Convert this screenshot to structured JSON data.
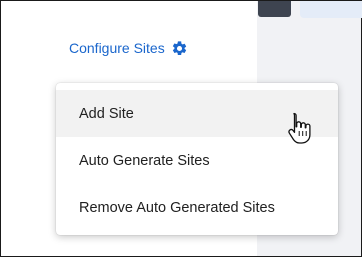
{
  "configure": {
    "label": "Configure Sites",
    "icon": "gear-icon",
    "color": "#1a66cc"
  },
  "menu": {
    "items": [
      {
        "label": "Add Site",
        "hovered": true
      },
      {
        "label": "Auto Generate Sites",
        "hovered": false
      },
      {
        "label": "Remove Auto Generated Sites",
        "hovered": false
      }
    ]
  },
  "cursor": {
    "icon": "hand-pointer-icon"
  }
}
